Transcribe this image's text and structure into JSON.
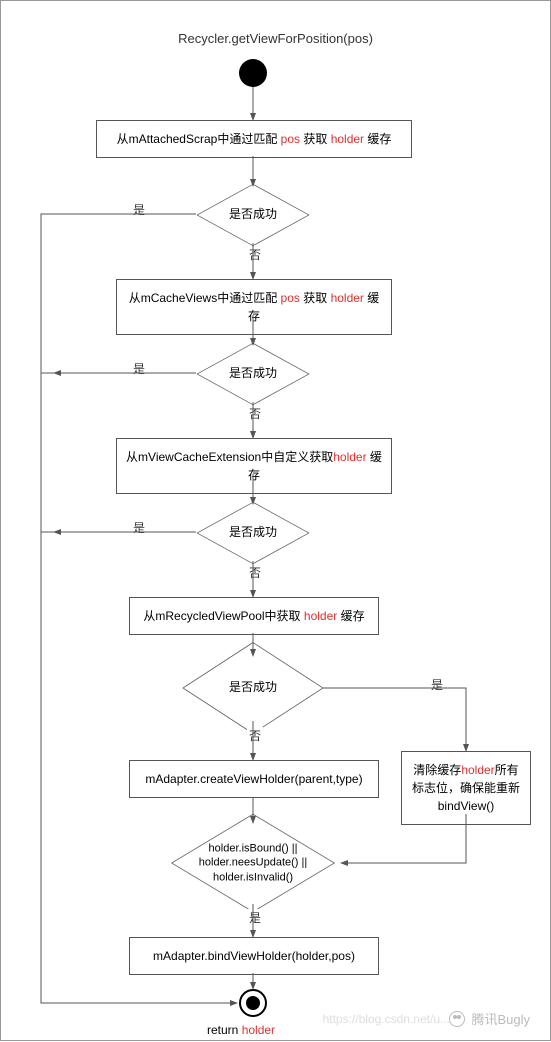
{
  "title": "Recycler.getViewForPosition(pos)",
  "b1_pre": "从mAttachedScrap中通过匹配 ",
  "b1_pos": "pos",
  "b1_mid": " 获取 ",
  "b1_holder": "holder",
  "b1_suf": " 缓存",
  "d_success": "是否成功",
  "yes": "是",
  "no": "否",
  "b2_pre": "从mCacheViews中通过匹配 ",
  "b2_pos": "pos",
  "b2_mid": " 获取 ",
  "b2_holder": "holder",
  "b2_suf": " 缓存",
  "b3_pre": "从mViewCacheExtension中自定义获取",
  "b3_holder": "holder",
  "b3_suf": " 缓存",
  "b4_pre": "从mRecycledViewPool中获取 ",
  "b4_holder": "holder",
  "b4_suf": " 缓存",
  "b5": "mAdapter.createViewHolder(parent,type)",
  "b6_pre": "清除缓存",
  "b6_holder": "holder",
  "b6_mid": "所有标志位，确保能重新bindView()",
  "d5_l1": "holder.isBound() ||",
  "d5_l2": "holder.neesUpdate() ||",
  "d5_l3": "holder.isInvalid()",
  "b7": "mAdapter.bindViewHolder(holder,pos)",
  "ret_pre": "return ",
  "ret_holder": "holder",
  "wm_right": "腾讯Bugly",
  "wm_bottom": "https://blog.csdn.net/u...",
  "chart_data": {
    "type": "flowchart",
    "title": "Recycler.getViewForPosition(pos)",
    "nodes": [
      {
        "id": "start",
        "type": "start"
      },
      {
        "id": "b1",
        "type": "process",
        "text": "从mAttachedScrap中通过匹配 pos 获取 holder 缓存"
      },
      {
        "id": "d1",
        "type": "decision",
        "text": "是否成功"
      },
      {
        "id": "b2",
        "type": "process",
        "text": "从mCacheViews中通过匹配 pos 获取 holder 缓存"
      },
      {
        "id": "d2",
        "type": "decision",
        "text": "是否成功"
      },
      {
        "id": "b3",
        "type": "process",
        "text": "从mViewCacheExtension中自定义获取holder 缓存"
      },
      {
        "id": "d3",
        "type": "decision",
        "text": "是否成功"
      },
      {
        "id": "b4",
        "type": "process",
        "text": "从mRecycledViewPool中获取 holder 缓存"
      },
      {
        "id": "d4",
        "type": "decision",
        "text": "是否成功"
      },
      {
        "id": "b5",
        "type": "process",
        "text": "mAdapter.createViewHolder(parent,type)"
      },
      {
        "id": "b6",
        "type": "process",
        "text": "清除缓存holder所有标志位，确保能重新bindView()"
      },
      {
        "id": "d5",
        "type": "decision",
        "text": "holder.isBound() || holder.neesUpdate() || holder.isInvalid()"
      },
      {
        "id": "b7",
        "type": "process",
        "text": "mAdapter.bindViewHolder(holder,pos)"
      },
      {
        "id": "end",
        "type": "end",
        "text": "return holder"
      }
    ],
    "edges": [
      {
        "from": "start",
        "to": "b1"
      },
      {
        "from": "b1",
        "to": "d1"
      },
      {
        "from": "d1",
        "to": "end",
        "label": "是"
      },
      {
        "from": "d1",
        "to": "b2",
        "label": "否"
      },
      {
        "from": "b2",
        "to": "d2"
      },
      {
        "from": "d2",
        "to": "end",
        "label": "是"
      },
      {
        "from": "d2",
        "to": "b3",
        "label": "否"
      },
      {
        "from": "b3",
        "to": "d3"
      },
      {
        "from": "d3",
        "to": "end",
        "label": "是"
      },
      {
        "from": "d3",
        "to": "b4",
        "label": "否"
      },
      {
        "from": "b4",
        "to": "d4"
      },
      {
        "from": "d4",
        "to": "b6",
        "label": "是"
      },
      {
        "from": "d4",
        "to": "b5",
        "label": "否"
      },
      {
        "from": "b5",
        "to": "d5"
      },
      {
        "from": "b6",
        "to": "d5"
      },
      {
        "from": "d5",
        "to": "b7",
        "label": "是"
      },
      {
        "from": "b7",
        "to": "end"
      }
    ]
  }
}
